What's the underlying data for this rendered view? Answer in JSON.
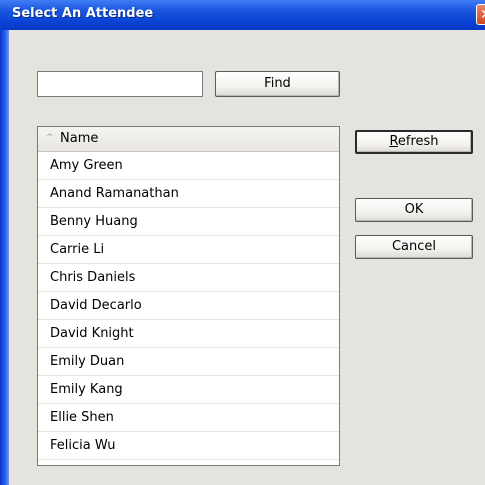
{
  "window": {
    "title": "Select An Attendee",
    "close_glyph": "✕"
  },
  "search": {
    "value": "",
    "find_label": "Find"
  },
  "list": {
    "header": "Name",
    "sort_icon": "^",
    "items": [
      "Amy Green",
      "Anand Ramanathan",
      "Benny Huang",
      "Carrie Li",
      "Chris Daniels",
      "David Decarlo",
      "David Knight",
      "Emily Duan",
      "Emily Kang",
      "Ellie Shen",
      "Felicia Wu"
    ]
  },
  "buttons": {
    "refresh_first": "R",
    "refresh_rest": "efresh",
    "ok": "OK",
    "cancel": "Cancel"
  },
  "colors": {
    "titlebar": "#0a44d6",
    "dialog_bg": "#e4e3dd"
  }
}
